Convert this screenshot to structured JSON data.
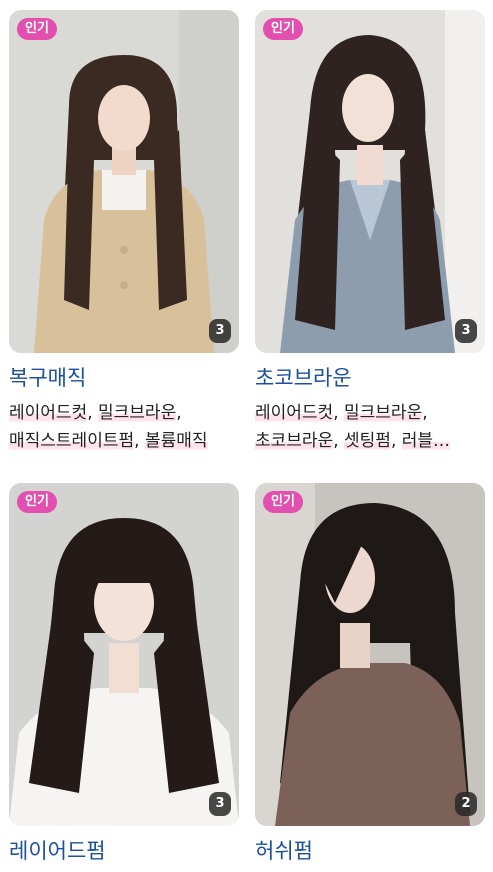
{
  "cards": [
    {
      "badge": "인기",
      "count": "3",
      "title": "복구매직",
      "tags": [
        [
          "레이어드컷",
          "밀크브라운"
        ],
        [
          "매직스트레이트펌",
          "볼륨매직"
        ]
      ]
    },
    {
      "badge": "인기",
      "count": "3",
      "title": "초코브라운",
      "tags": [
        [
          "레이어드컷",
          "밀크브라운"
        ],
        [
          "초코브라운",
          "셋팅펌",
          "러블…"
        ]
      ]
    },
    {
      "badge": "인기",
      "count": "3",
      "title": "레이어드펌",
      "tags": []
    },
    {
      "badge": "인기",
      "count": "2",
      "title": "허쉬펌",
      "tags": []
    }
  ],
  "colors": {
    "badge": "#e24fae",
    "title": "#1d4f9e",
    "highlight": "#fde3ee"
  }
}
